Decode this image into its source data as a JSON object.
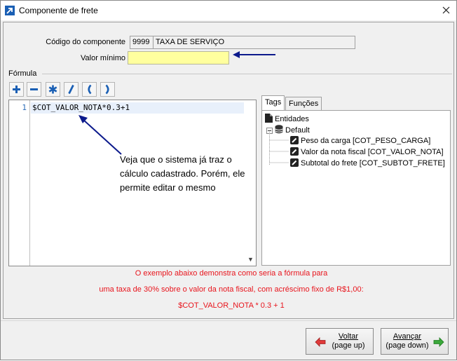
{
  "window": {
    "title": "Componente de frete",
    "icon": "app-arrow-icon",
    "close_icon": "close-icon"
  },
  "form": {
    "codigo_label": "Código do componente",
    "codigo_value": "9999",
    "descricao_value": "TAXA DE SERVIÇO",
    "valor_minimo_label": "Valor mínimo",
    "valor_minimo_value": ""
  },
  "formula": {
    "section_label": "Fórmula",
    "toolbar": [
      {
        "name": "plus-icon",
        "symbol": "+"
      },
      {
        "name": "minus-icon",
        "symbol": "−"
      },
      {
        "name": "asterisk-icon",
        "symbol": "*"
      },
      {
        "name": "slash-icon",
        "symbol": "/"
      },
      {
        "name": "open-paren-icon",
        "symbol": "("
      },
      {
        "name": "close-paren-icon",
        "symbol": ")"
      }
    ],
    "editor": {
      "line_number": "1",
      "code": "$COT_VALOR_NOTA*0.3+1"
    },
    "annotation": "Veja que o sistema já traz o cálculo cadastrado. Porém, ele permite editar o mesmo"
  },
  "tabs": {
    "items": [
      "Tags",
      "Funções"
    ],
    "active": "Tags"
  },
  "tree": {
    "root": "Entidades",
    "group": "Default",
    "items": [
      "Peso da carga [COT_PESO_CARGA]",
      "Valor da nota fiscal [COT_VALOR_NOTA]",
      "Subtotal do frete [COT_SUBTOT_FRETE]"
    ]
  },
  "hints": {
    "line1": "O exemplo abaixo demonstra como seria a fórmula para",
    "line2": "uma taxa de 30% sobre o valor da nota fiscal, com acréscimo fixo de R$1,00:",
    "line3": "$COT_VALOR_NOTA * 0.3 + 1"
  },
  "footer": {
    "back": {
      "label": "Voltar",
      "sub": "(page up)"
    },
    "next": {
      "label": "Avançar",
      "sub": "(page down)"
    }
  },
  "colors": {
    "accent_blue": "#1a5fb4",
    "hint_red": "#e8141c",
    "field_yellow": "#ffff9e",
    "arrow_navy": "#0c1a8c",
    "back_arrow": "#e03a3a",
    "next_arrow": "#3aa83a"
  }
}
